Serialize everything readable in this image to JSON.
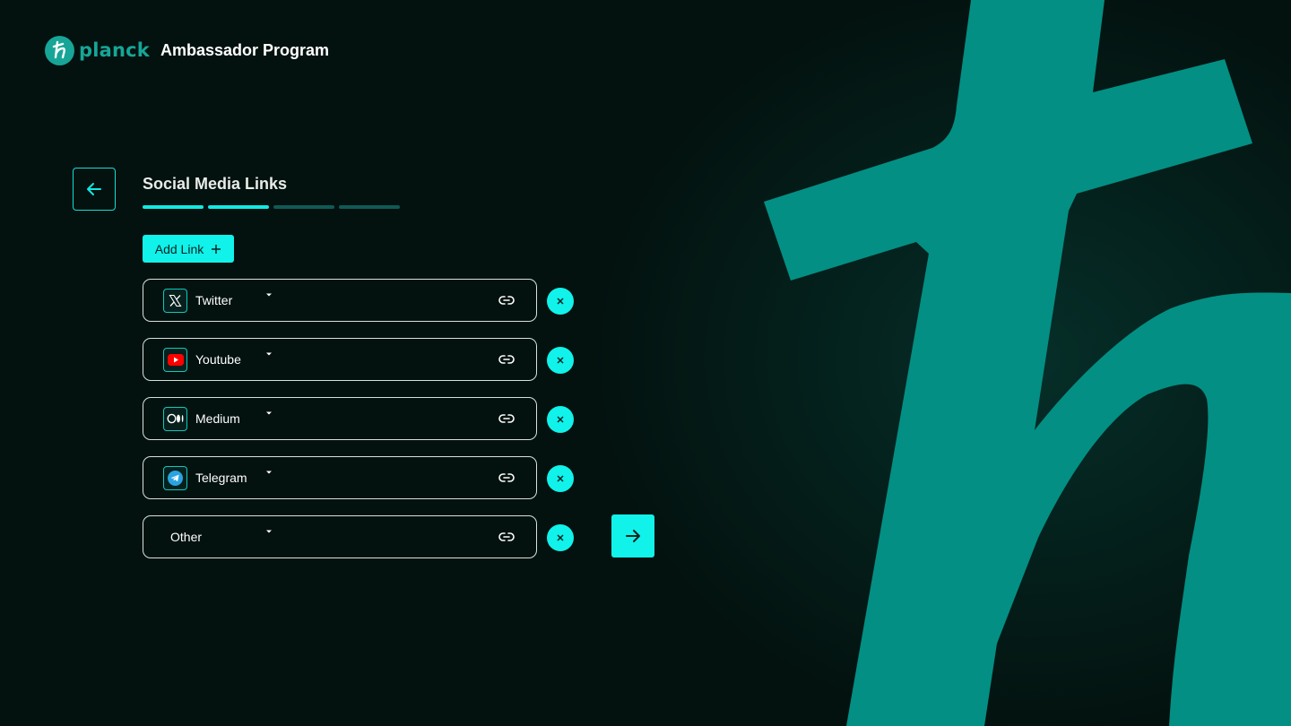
{
  "header": {
    "brand_name": "planck",
    "program_title": "Ambassador Program"
  },
  "form": {
    "title": "Social Media Links",
    "steps_total": 4,
    "steps_completed": 2,
    "add_link_label": "Add Link",
    "rows": [
      {
        "platform": "Twitter",
        "icon": "x-twitter-icon"
      },
      {
        "platform": "Youtube",
        "icon": "youtube-icon"
      },
      {
        "platform": "Medium",
        "icon": "medium-icon"
      },
      {
        "platform": "Telegram",
        "icon": "telegram-icon"
      },
      {
        "platform": "Other",
        "icon": ""
      }
    ]
  },
  "colors": {
    "background": "#03120f",
    "accent": "#10f2ea",
    "brand_teal": "#17a597",
    "watermark": "#038f84"
  }
}
